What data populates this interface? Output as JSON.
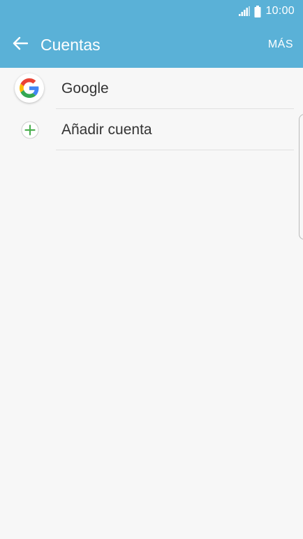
{
  "status_bar": {
    "time": "10:00",
    "icons": [
      "signal-icon",
      "battery-icon"
    ]
  },
  "app_bar": {
    "title": "Cuentas",
    "back_icon": "arrow-left-icon",
    "more_label": "MÁS"
  },
  "accounts": {
    "items": [
      {
        "label": "Google",
        "icon": "google-icon"
      },
      {
        "label": "Añadir cuenta",
        "icon": "plus-icon"
      }
    ]
  },
  "colors": {
    "header": "#5ab1d7",
    "background": "#f7f7f7",
    "text": "#333333",
    "plus": "#4caf50"
  }
}
